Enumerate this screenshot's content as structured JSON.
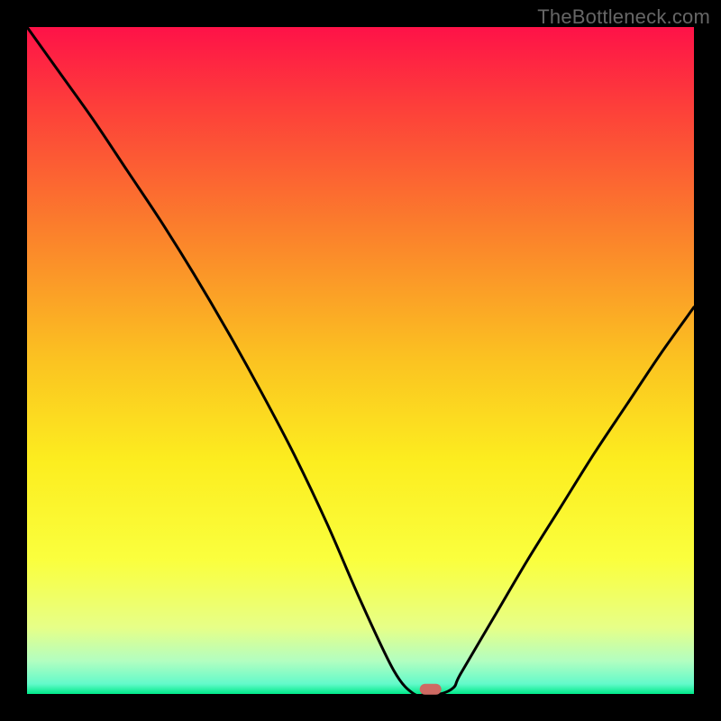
{
  "watermark": "TheBottleneck.com",
  "chart_data": {
    "type": "line",
    "title": "",
    "xlabel": "",
    "ylabel": "",
    "xlim": [
      0,
      100
    ],
    "ylim": [
      0,
      100
    ],
    "x": [
      0,
      5,
      10,
      15,
      20,
      25,
      30,
      35,
      40,
      45,
      50,
      55,
      58,
      60,
      62,
      64,
      65,
      70,
      75,
      80,
      85,
      90,
      95,
      100
    ],
    "y": [
      100,
      93,
      86,
      78.5,
      71,
      63,
      54.5,
      45.5,
      36,
      25.5,
      14,
      3.5,
      0,
      0,
      0,
      1,
      3,
      11.5,
      20,
      28,
      36,
      43.5,
      51,
      58
    ],
    "notch": {
      "x_min": 58,
      "x_max": 62,
      "y": 0
    },
    "marker": {
      "x": 60.5,
      "y": 0.7
    },
    "gradient_stops": [
      {
        "offset": 0.0,
        "color": "#fe1248"
      },
      {
        "offset": 0.12,
        "color": "#fd3f3a"
      },
      {
        "offset": 0.3,
        "color": "#fb7e2c"
      },
      {
        "offset": 0.5,
        "color": "#fbc321"
      },
      {
        "offset": 0.65,
        "color": "#fced1f"
      },
      {
        "offset": 0.8,
        "color": "#faff3e"
      },
      {
        "offset": 0.9,
        "color": "#e7ff87"
      },
      {
        "offset": 0.95,
        "color": "#b3fec0"
      },
      {
        "offset": 0.985,
        "color": "#63faca"
      },
      {
        "offset": 1.0,
        "color": "#00e989"
      }
    ]
  }
}
